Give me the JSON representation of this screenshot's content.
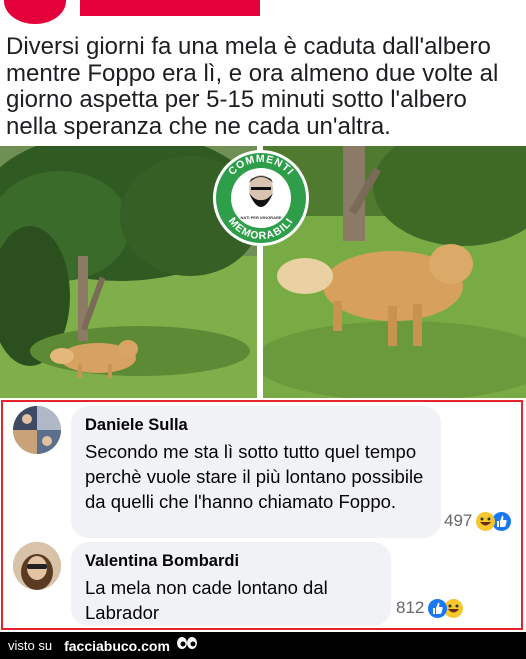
{
  "post": {
    "text": "Diversi giorni fa una mela è caduta dall'albero mentre Foppo era lì, e ora almeno due volte al giorno aspetta per 5-15 minuti sotto l'albero nella speranza che ne cada un'altra."
  },
  "badge": {
    "top_text": "COMMENTI",
    "bottom_text": "MEMORABILI",
    "small_text": "NATI PER IGNORARE",
    "color": "#2e9e4b",
    "icon": "bearded-man-icon"
  },
  "comments": [
    {
      "author": "Daniele Sulla",
      "text": "Secondo me sta lì sotto tutto quel tempo perchè vuole stare il più lontano possibile da quelli che l'hanno chiamato Foppo.",
      "reaction_count": "497",
      "reaction_icons": [
        "laugh-emoji-icon",
        "like-icon"
      ]
    },
    {
      "author": "Valentina Bombardi",
      "text": "La mela non cade lontano dal Labrador",
      "reaction_count": "812",
      "reaction_icons": [
        "like-icon",
        "laugh-emoji-icon"
      ]
    }
  ],
  "footer": {
    "visto": "visto su",
    "site": "facciabuco.com",
    "icon": "eyes-icon"
  },
  "colors": {
    "accent_red": "#e4262c",
    "like_blue": "#1877f2",
    "laugh_yellow": "#f7c72f"
  }
}
